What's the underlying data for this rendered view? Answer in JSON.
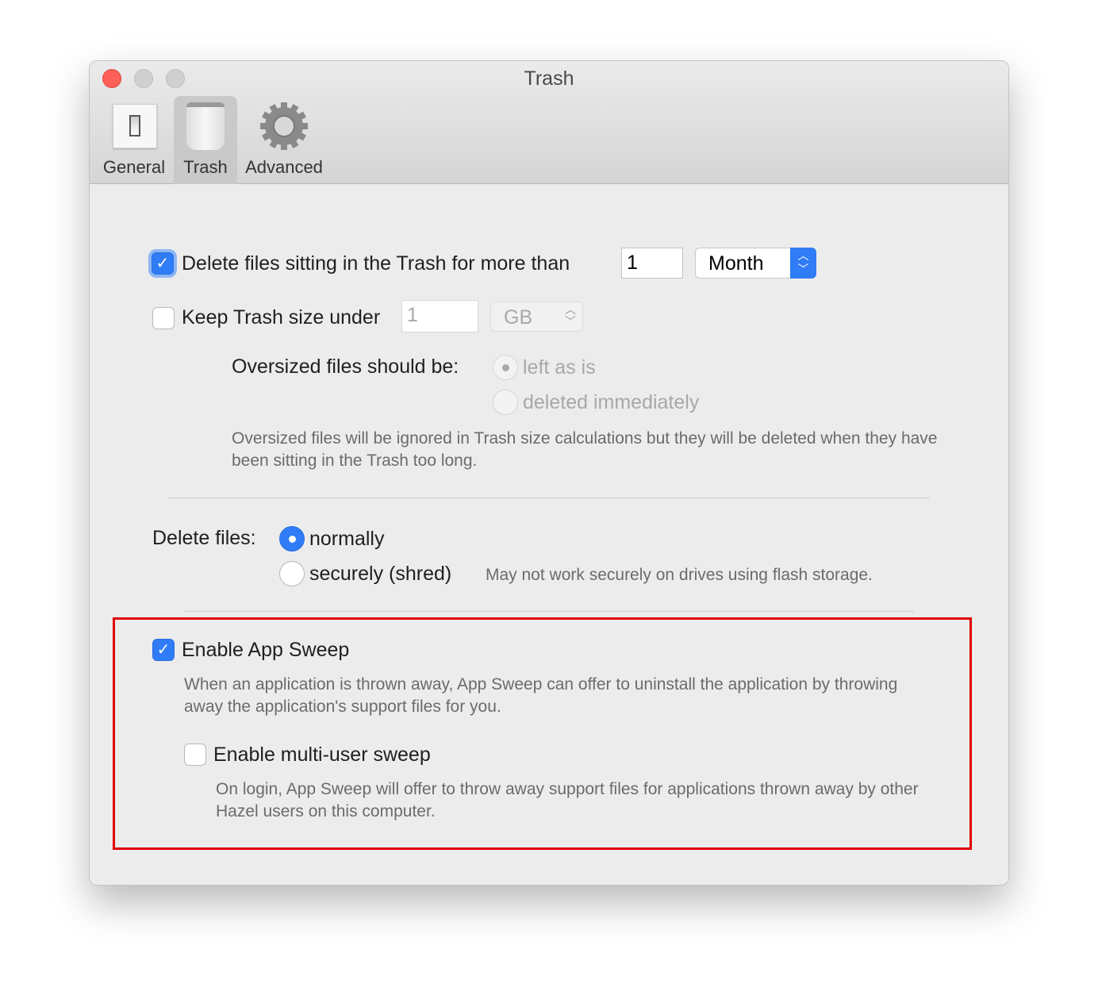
{
  "window": {
    "title": "Trash"
  },
  "toolbar": {
    "tabs": [
      {
        "label": "General",
        "icon": "switch-icon"
      },
      {
        "label": "Trash",
        "icon": "trash-icon",
        "selected": true
      },
      {
        "label": "Advanced",
        "icon": "gear-icon"
      }
    ]
  },
  "delete_old": {
    "label": "Delete files sitting in the Trash for more than",
    "checked": true,
    "value": "1",
    "unit": "Month"
  },
  "size_limit": {
    "label": "Keep Trash size under",
    "checked": false,
    "value": "1",
    "unit": "GB"
  },
  "oversized": {
    "label": "Oversized files should be:",
    "options": [
      "left as is",
      "deleted immediately"
    ],
    "selected": "left as is",
    "note": "Oversized files will be ignored in Trash size calculations but they will be deleted when they have been sitting in the Trash too long."
  },
  "delete_mode": {
    "label": "Delete files:",
    "options": [
      "normally",
      "securely (shred)"
    ],
    "selected": "normally",
    "note": "May not work securely on drives using flash storage."
  },
  "app_sweep": {
    "label": "Enable App Sweep",
    "checked": true,
    "note": "When an application is thrown away, App Sweep can offer to uninstall the application by throwing away the application's support files for you."
  },
  "multi_user": {
    "label": "Enable multi-user sweep",
    "checked": false,
    "note": "On login, App Sweep will offer to throw away support files for applications thrown away by other Hazel users on this computer."
  },
  "colors": {
    "accent": "#2f7cf6",
    "highlight_box": "#e00000"
  }
}
